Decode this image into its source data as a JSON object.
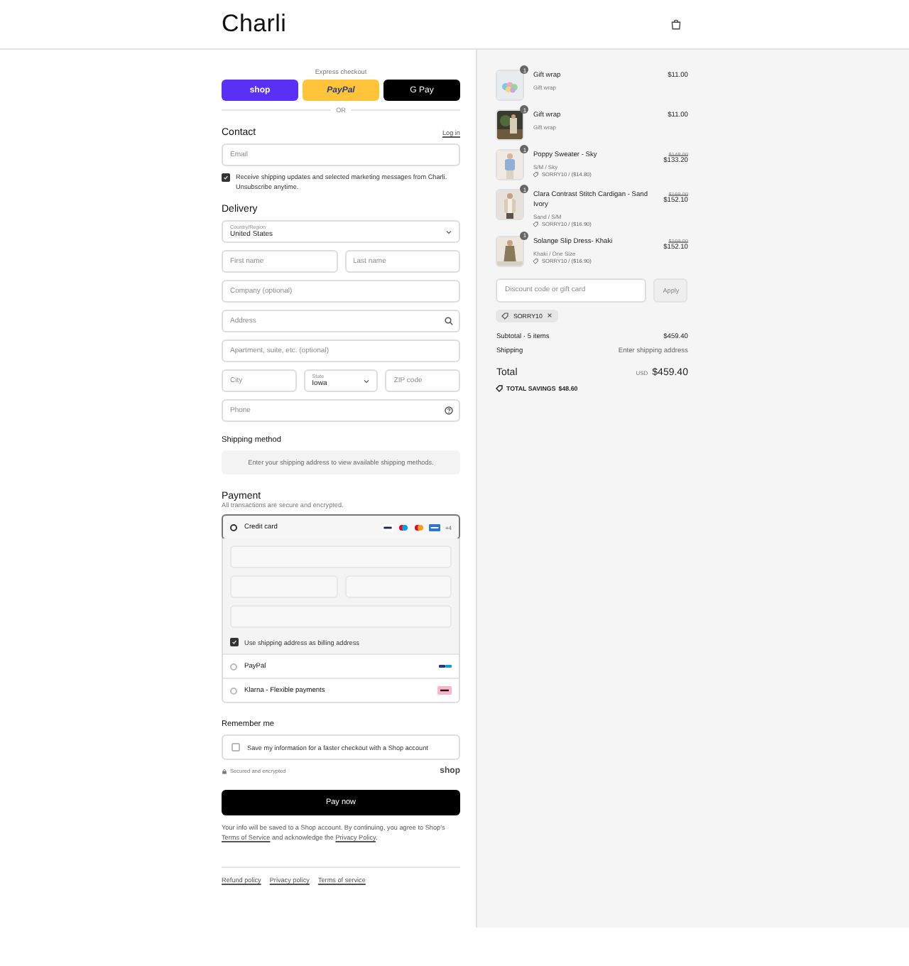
{
  "header": {
    "logo": "Charli"
  },
  "express_checkout": {
    "label": "Express checkout",
    "separator": "OR",
    "buttons": [
      {
        "label": "shop",
        "kind": "shop"
      },
      {
        "label": "PayPal",
        "kind": "paypal"
      },
      {
        "label": "G Pay",
        "kind": "gpay"
      }
    ]
  },
  "contact": {
    "title": "Contact",
    "login_link": "Log in",
    "email": {
      "placeholder": "Email"
    },
    "marketing": {
      "label": "Receive shipping updates and selected marketing messages from Charli. Unsubscribe anytime.",
      "checked": true
    }
  },
  "delivery": {
    "title": "Delivery",
    "rows": [
      [
        {
          "kind": "select",
          "label": "Country/Region",
          "value": "United States"
        }
      ],
      [
        {
          "kind": "text",
          "placeholder": "First name"
        },
        {
          "kind": "text",
          "placeholder": "Last name"
        }
      ],
      [
        {
          "kind": "text",
          "placeholder": "Company (optional)"
        }
      ],
      [
        {
          "kind": "search",
          "placeholder": "Address"
        }
      ],
      [
        {
          "kind": "text",
          "placeholder": "Apartment, suite, etc. (optional)"
        }
      ],
      [
        {
          "kind": "text",
          "placeholder": "City"
        },
        {
          "kind": "select",
          "label": "State",
          "value": "Iowa"
        },
        {
          "kind": "text",
          "placeholder": "ZIP code"
        }
      ],
      [
        {
          "kind": "phone",
          "placeholder": "Phone"
        }
      ]
    ]
  },
  "shipping_method": {
    "title": "Shipping method",
    "notice": "Enter your shipping address to view available shipping methods."
  },
  "payment": {
    "title": "Payment",
    "subtitle": "All transactions are secure and encrypted.",
    "card_more": "+4",
    "billing_same": {
      "label": "Use shipping address as billing address",
      "checked": true
    },
    "methods": [
      {
        "label": "Credit card",
        "kind": "card",
        "selected": true
      },
      {
        "label": "PayPal",
        "kind": "paypal",
        "selected": false
      },
      {
        "label": "Klarna - Flexible payments",
        "kind": "klarna",
        "selected": false
      }
    ]
  },
  "remember_me": {
    "title": "Remember me",
    "save": {
      "label": "Save my information for a faster checkout with a Shop account",
      "checked": false
    },
    "secure_note": "Secured and encrypted",
    "shop_logo": "shop"
  },
  "pay_button": "Pay now",
  "legal": {
    "before": "Your info will be saved to a Shop account. By continuing, you agree to Shop's",
    "terms_link": "Terms of Service",
    "middle": "and acknowledge the",
    "privacy_link": "Privacy Policy",
    "after": "."
  },
  "footer_links": [
    "Refund policy",
    "Privacy policy",
    "Terms of service"
  ],
  "summary": {
    "items": [
      {
        "name": "Gift wrap",
        "variant": "Gift wrap",
        "quantity": "1",
        "price": "$11.00"
      },
      {
        "name": "Gift wrap",
        "variant": "Gift wrap",
        "quantity": "1",
        "price": "$11.00"
      },
      {
        "name": "Poppy Sweater - Sky",
        "variant": "S/M / Sky",
        "quantity": "1",
        "original_price": "$148.00",
        "price": "$133.20",
        "discount": "SORRY10 / ($14.80)"
      },
      {
        "name": "Clara Contrast Stitch Cardigan - Sand Ivory",
        "variant": "Sand / S/M",
        "quantity": "1",
        "original_price": "$169.00",
        "price": "$152.10",
        "discount": "SORRY10 / ($16.90)"
      },
      {
        "name": "Solange Slip Dress- Khaki",
        "variant": "Khaki / One Size",
        "quantity": "1",
        "original_price": "$169.00",
        "price": "$152.10",
        "discount": "SORRY10 / ($16.90)"
      }
    ],
    "discount_field": {
      "placeholder": "Discount code or gift card"
    },
    "apply_button": "Apply",
    "applied_code": "SORRY10",
    "subtotal": {
      "label": "Subtotal · 5 items",
      "value": "$459.40"
    },
    "shipping": {
      "label": "Shipping",
      "value": "Enter shipping address"
    },
    "total": {
      "label": "Total",
      "currency": "USD",
      "value": "$459.40"
    },
    "savings": {
      "label": "TOTAL SAVINGS",
      "value": "$48.60"
    }
  }
}
